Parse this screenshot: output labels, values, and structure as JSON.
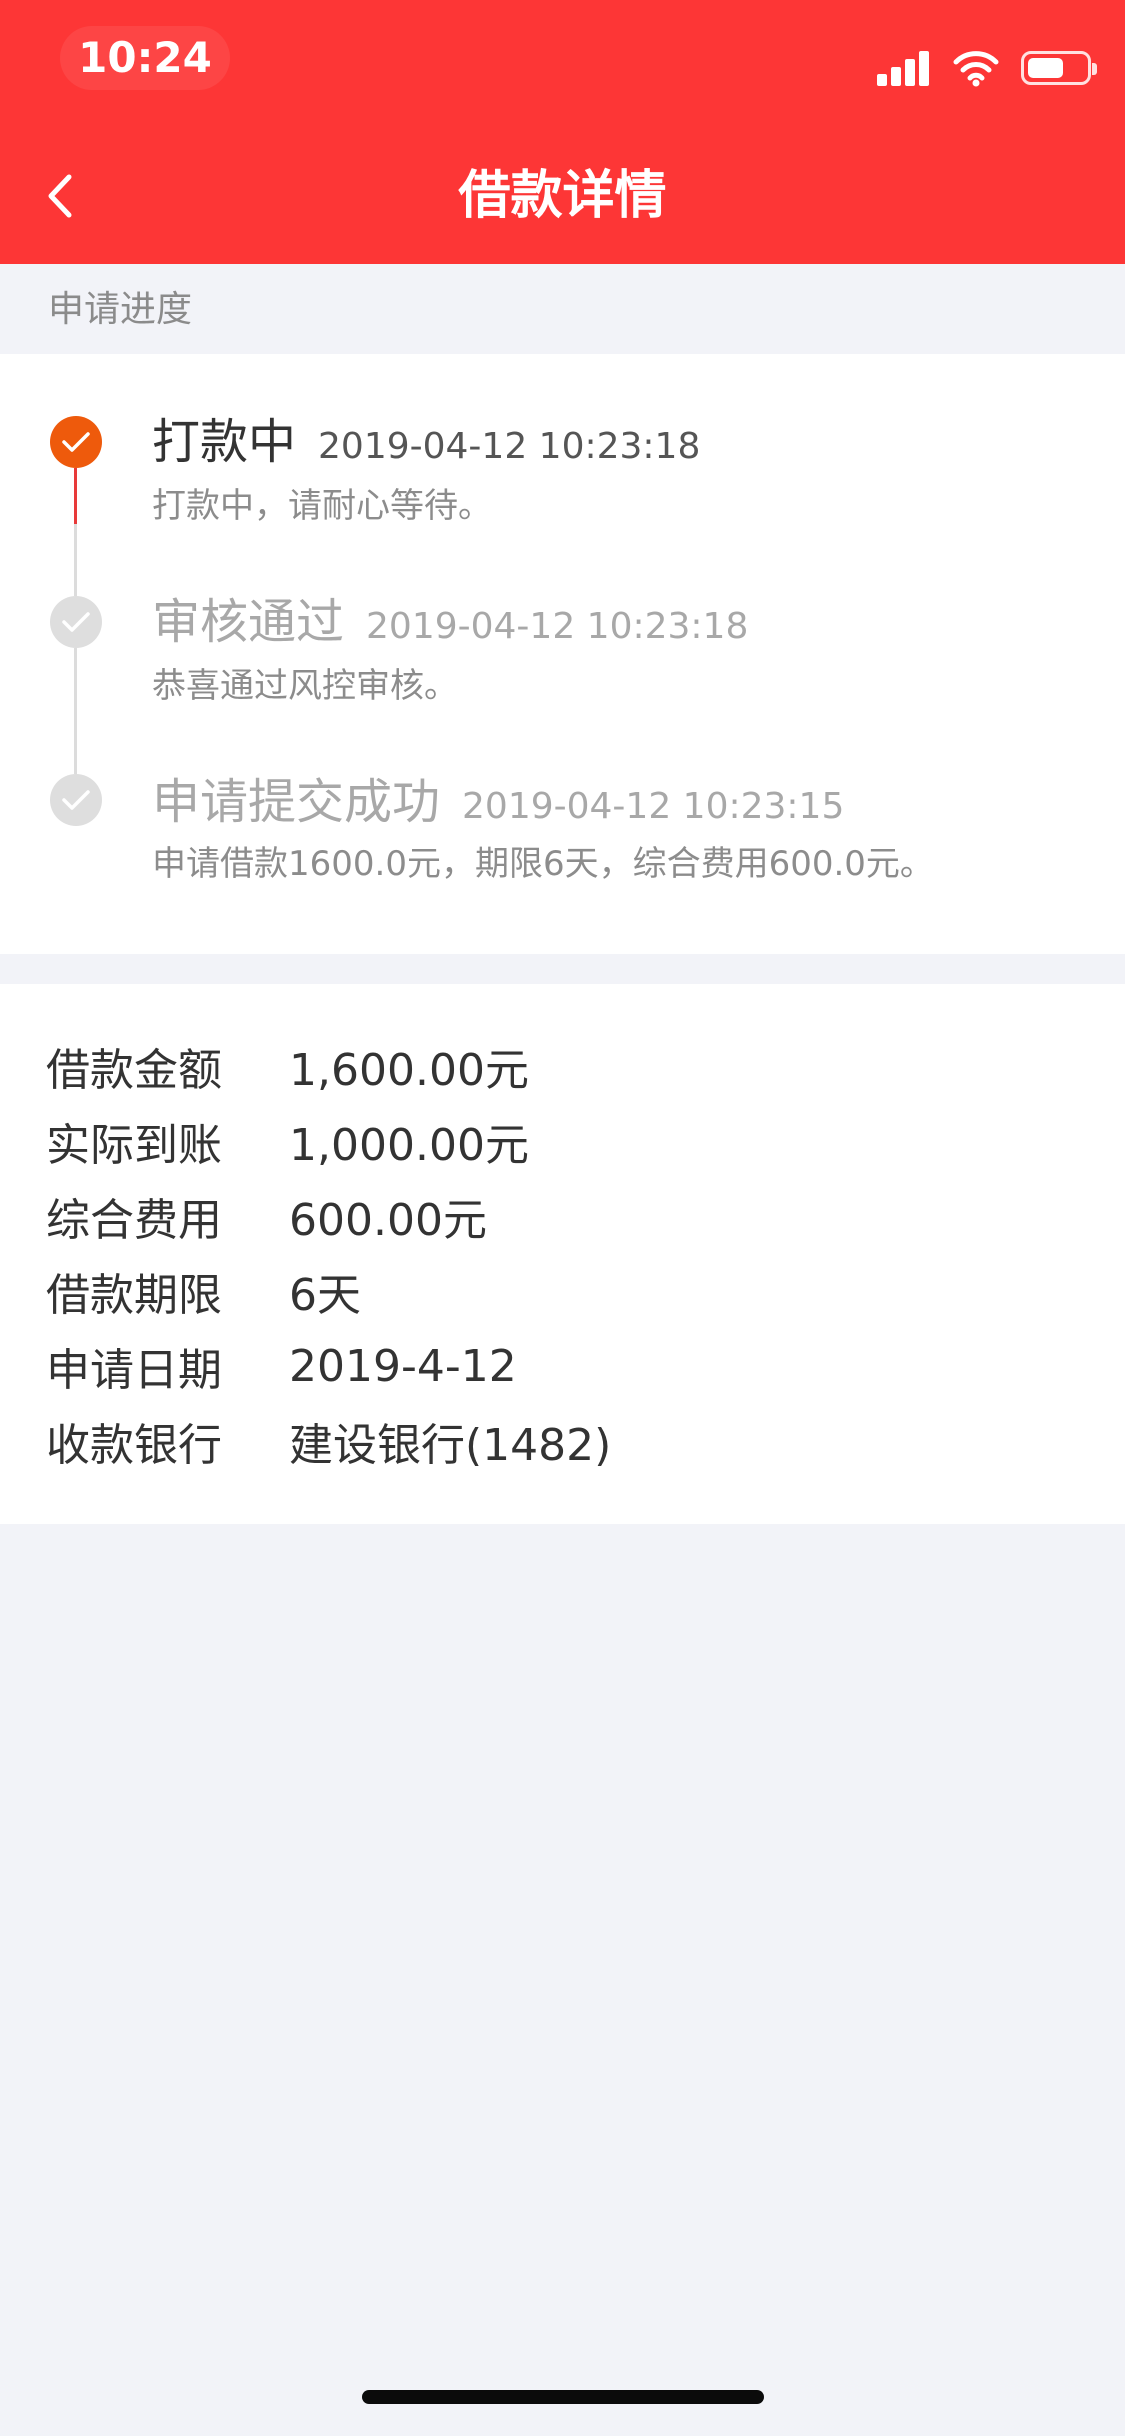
{
  "status_bar": {
    "time": "10:24"
  },
  "nav": {
    "title": "借款详情"
  },
  "progress": {
    "section_label": "申请进度",
    "steps": [
      {
        "title": "打款中",
        "time": "2019-04-12 10:23:18",
        "desc": "打款中，请耐心等待。",
        "state": "active"
      },
      {
        "title": "审核通过",
        "time": "2019-04-12 10:23:18",
        "desc": "恭喜通过风控审核。",
        "state": "done"
      },
      {
        "title": "申请提交成功",
        "time": "2019-04-12 10:23:15",
        "desc": "申请借款1600.0元，期限6天，综合费用600.0元。",
        "state": "done"
      }
    ]
  },
  "details": [
    {
      "label": "借款金额",
      "value": "1,600.00元"
    },
    {
      "label": "实际到账",
      "value": "1,000.00元"
    },
    {
      "label": "综合费用",
      "value": "600.00元"
    },
    {
      "label": "借款期限",
      "value": "6天"
    },
    {
      "label": "申请日期",
      "value": "2019-4-12"
    },
    {
      "label": "收款银行",
      "value": "建设银行(1482)"
    }
  ],
  "battery_level": 0.6,
  "colors": {
    "brand": "#fd3636",
    "active_dot": "#ee5a0c",
    "active_line": "#e83a3a",
    "inactive_dot": "#dedede",
    "inactive_line": "#dcdcdc"
  },
  "icons": [
    "back-chevron-icon",
    "signal-icon",
    "wifi-icon",
    "battery-icon",
    "check-icon"
  ]
}
